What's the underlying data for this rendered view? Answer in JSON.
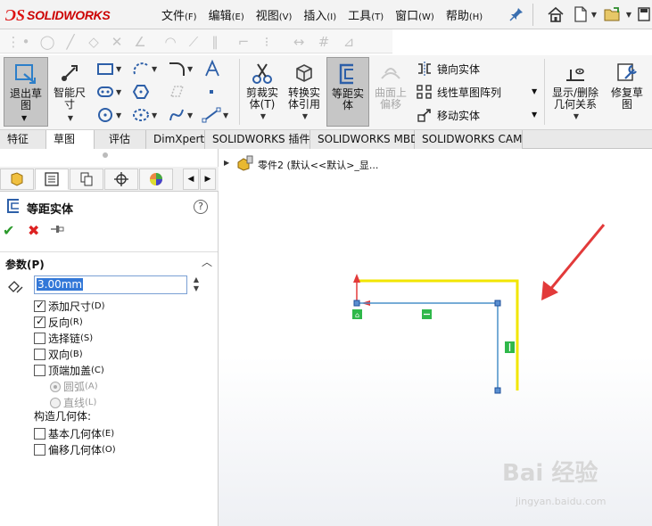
{
  "app": {
    "logo_ds": "ƆS",
    "logo_text": "SOLIDWORKS",
    "brand_color": "#cc0000"
  },
  "menu": [
    {
      "label": "文件",
      "key": "(F)"
    },
    {
      "label": "编辑",
      "key": "(E)"
    },
    {
      "label": "视图",
      "key": "(V)"
    },
    {
      "label": "插入",
      "key": "(I)"
    },
    {
      "label": "工具",
      "key": "(T)"
    },
    {
      "label": "窗口",
      "key": "(W)"
    },
    {
      "label": "帮助",
      "key": "(H)"
    }
  ],
  "ribbon": {
    "exit_sketch": "退出草图",
    "smart_dim": "智能尺寸",
    "trim": "剪裁实体(T)",
    "convert": "转换实体引用",
    "offset": "等距实体",
    "surface_offset": "曲面上偏移",
    "mirror": "镜向实体",
    "linear_pattern": "线性草图阵列",
    "move": "移动实体",
    "show_relations": "显示/删除几何关系",
    "repair": "修复草图"
  },
  "tabs": [
    "特征",
    "草图",
    "评估",
    "DimXpert",
    "SOLIDWORKS 插件",
    "SOLIDWORKS MBD",
    "SOLIDWORKS CAM"
  ],
  "active_tab": "草图",
  "property_manager": {
    "title": "等距实体",
    "help": "?",
    "section_params": "参数(P)",
    "offset_value": "3.00mm",
    "options": [
      {
        "label": "添加尺寸",
        "key": "(D)",
        "checked": true
      },
      {
        "label": "反向",
        "key": "(R)",
        "checked": true
      },
      {
        "label": "选择链",
        "key": "(S)",
        "checked": false
      },
      {
        "label": "双向",
        "key": "(B)",
        "checked": false
      },
      {
        "label": "顶端加盖",
        "key": "(C)",
        "checked": false
      }
    ],
    "cap_options": [
      {
        "label": "圆弧",
        "key": "(A)",
        "selected": true
      },
      {
        "label": "直线",
        "key": "(L)",
        "selected": false
      }
    ],
    "construct_label": "构造几何体:",
    "construct_options": [
      {
        "label": "基本几何体",
        "key": "(E)",
        "checked": false
      },
      {
        "label": "偏移几何体",
        "key": "(O)",
        "checked": false
      }
    ]
  },
  "tree": {
    "part_label": "零件2 (默认<<默认>_显..."
  },
  "colors": {
    "offset_preview": "#f2e600",
    "sketch_line": "#4a90c8",
    "arrow": "#e23a3a",
    "relation_badge": "#2fb84a"
  },
  "watermark": {
    "main": "Bai 经验",
    "sub": "jingyan.baidu.com"
  }
}
